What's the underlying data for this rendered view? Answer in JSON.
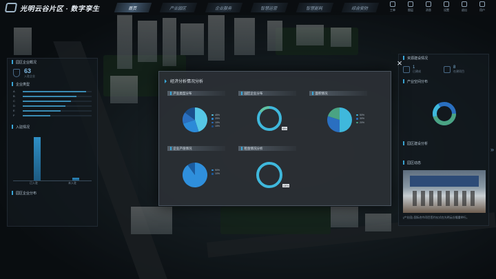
{
  "app": {
    "title": "光明云谷片区 · 数字孪生"
  },
  "nav": [
    {
      "label": "首页",
      "active": true
    },
    {
      "label": "产业园区",
      "active": false
    },
    {
      "label": "企业服务",
      "active": false
    },
    {
      "label": "智慧运营",
      "active": false
    },
    {
      "label": "智慧能耗",
      "active": false
    },
    {
      "label": "综合安防",
      "active": false
    }
  ],
  "tools": [
    {
      "label": "工单",
      "icon": "document-icon"
    },
    {
      "label": "图层",
      "icon": "layers-icon"
    },
    {
      "label": "消息",
      "icon": "bell-icon"
    },
    {
      "label": "设置",
      "icon": "gear-icon"
    },
    {
      "label": "退出",
      "icon": "exit-icon"
    },
    {
      "label": "用户",
      "icon": "user-icon"
    }
  ],
  "left_panel": {
    "title": "园区企业概况",
    "stat_num": "63",
    "stat_sub": "入驻企业",
    "bars_title": "企业类型",
    "bars": [
      {
        "name": "A",
        "value": 0.92
      },
      {
        "name": "B",
        "value": 0.78
      },
      {
        "name": "C",
        "value": 0.7
      },
      {
        "name": "D",
        "value": 0.62
      },
      {
        "name": "E",
        "value": 0.55
      },
      {
        "name": "F",
        "value": 0.4
      }
    ],
    "vbars_title": "入驻情况",
    "vbars": [
      {
        "label": "已入驻",
        "value": 0.95
      },
      {
        "label": "未入驻",
        "value": 0.06
      }
    ],
    "footer": "园区企业分布"
  },
  "right_panel": {
    "title": "资源建设情况",
    "stats": [
      {
        "num": "1",
        "sub": "已建成"
      },
      {
        "num": "8",
        "sub": "在建项目"
      }
    ],
    "donut_title": "产业空间分布",
    "donut_values": [
      0.55,
      0.25,
      0.2
    ],
    "subtitle": "园区建设分析",
    "news_title": "园区动态",
    "news_text": "(产业园) 国际合作项目签约仪式在光明云谷隆重举行。"
  },
  "modal": {
    "title": "经济分析情况分析",
    "close": "×"
  },
  "chart_data": [
    {
      "type": "pie",
      "title": "产业类型分布",
      "series": [
        {
          "values": [
            45,
            25,
            15,
            15
          ]
        }
      ],
      "colors": [
        "#56c7e6",
        "#2c8ad8",
        "#2a6fc0",
        "#1a4f8c"
      ]
    },
    {
      "type": "pie",
      "title": "园区企业分布",
      "series": [
        {
          "values": [
            85,
            15
          ]
        }
      ],
      "colors": [
        "#3fb8dc",
        "#5fc2a4"
      ]
    },
    {
      "type": "pie",
      "title": "面积情况",
      "series": [
        {
          "values": [
            50,
            30,
            20
          ]
        }
      ],
      "colors": [
        "#3fb8dc",
        "#2a6fc0",
        "#4aa383"
      ]
    },
    {
      "type": "pie",
      "title": "企业产值情况",
      "series": [
        {
          "values": [
            90,
            10
          ]
        }
      ],
      "colors": [
        "#2f8fdc",
        "#1b5ca0"
      ]
    },
    {
      "type": "pie",
      "title": "租金情况分析",
      "series": [
        {
          "values": [
            100
          ]
        }
      ],
      "colors": [
        "#3fb8dc"
      ]
    }
  ]
}
